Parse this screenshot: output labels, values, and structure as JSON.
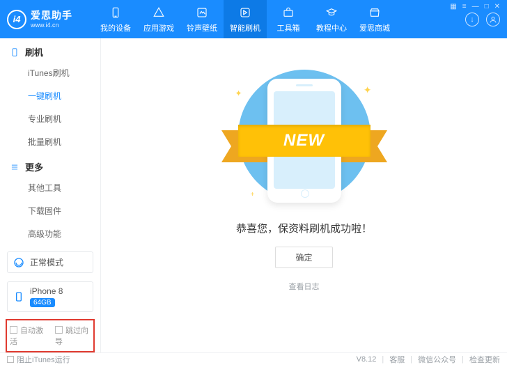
{
  "app": {
    "title": "爱思助手",
    "subtitle": "www.i4.cn"
  },
  "titlebar": {
    "t0": "▦",
    "t1": "≡",
    "t2": "—",
    "t3": "□",
    "t4": "✕"
  },
  "nav": {
    "device": "我的设备",
    "apps": "应用游戏",
    "rings": "铃声壁纸",
    "flash": "智能刷机",
    "tools": "工具箱",
    "tutorial": "教程中心",
    "store": "爱思商城"
  },
  "hdr_icons": {
    "download": "↓",
    "user": "◡"
  },
  "sidebar": {
    "g1": {
      "title": "刷机",
      "items": [
        "iTunes刷机",
        "一键刷机",
        "专业刷机",
        "批量刷机"
      ],
      "active_index": 1
    },
    "g2": {
      "title": "更多",
      "items": [
        "其他工具",
        "下载固件",
        "高级功能"
      ]
    },
    "mode": "正常模式",
    "device": {
      "name": "iPhone 8",
      "storage": "64GB"
    },
    "opts": {
      "auto_activate": "自动激活",
      "skip_guide": "跳过向导"
    }
  },
  "main": {
    "ribbon_text": "NEW",
    "success_msg": "恭喜您，保资料刷机成功啦！",
    "ok_button": "确定",
    "view_log": "查看日志"
  },
  "footer": {
    "block_itunes": "阻止iTunes运行",
    "version": "V8.12",
    "support": "客服",
    "wechat": "微信公众号",
    "update": "检查更新"
  }
}
